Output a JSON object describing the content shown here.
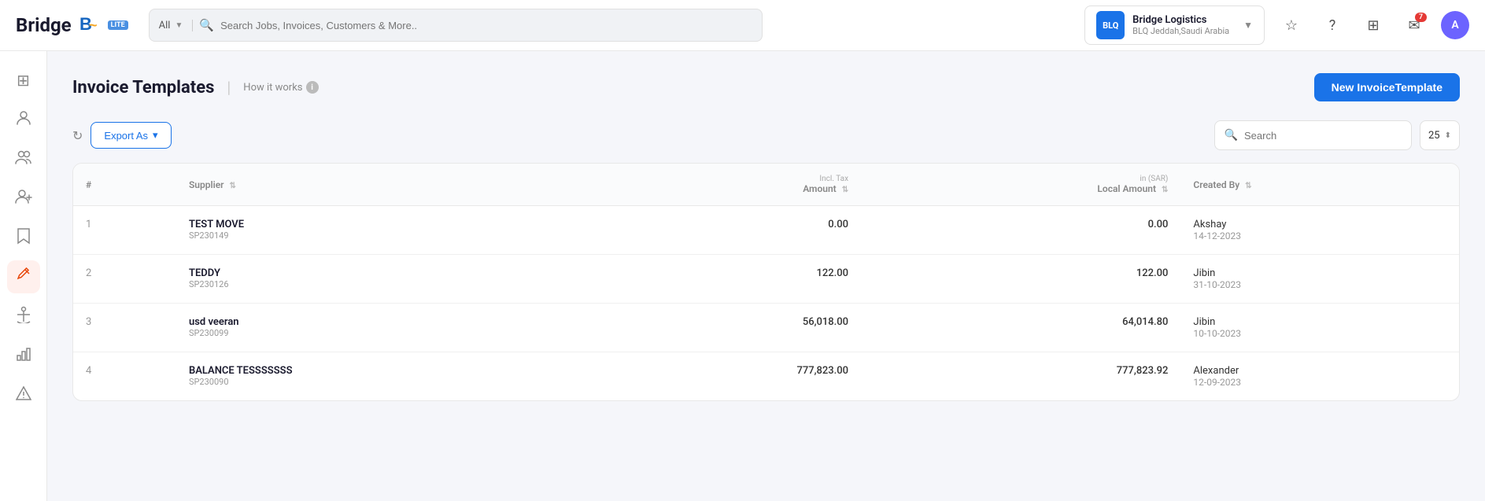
{
  "app": {
    "logo_text": "Bridge",
    "logo_badge": "LITE",
    "logo_icon_text": "B"
  },
  "topnav": {
    "search_dropdown_label": "All",
    "search_placeholder": "Search Jobs, Invoices, Customers & More..",
    "company": {
      "logo_text": "BLQ",
      "name": "Bridge Logistics",
      "sub": "BLQ Jeddah,Saudi Arabia"
    },
    "notifications_badge": "7",
    "avatar_text": "A"
  },
  "sidebar": {
    "items": [
      {
        "icon": "⊞",
        "name": "dashboard-icon",
        "active": false
      },
      {
        "icon": "👤",
        "name": "person-icon",
        "active": false
      },
      {
        "icon": "👥",
        "name": "group-icon",
        "active": false
      },
      {
        "icon": "➕",
        "name": "add-person-icon",
        "active": false
      },
      {
        "icon": "🔖",
        "name": "bookmark-icon",
        "active": false
      },
      {
        "icon": "✏️",
        "name": "edit-icon",
        "active": true
      },
      {
        "icon": "⚓",
        "name": "anchor-icon",
        "active": false
      },
      {
        "icon": "📊",
        "name": "chart-icon",
        "active": false
      },
      {
        "icon": "⚠️",
        "name": "alert-icon",
        "active": false
      }
    ]
  },
  "page": {
    "title": "Invoice Templates",
    "how_it_works": "How it works",
    "new_template_btn": "New InvoiceTemplate"
  },
  "toolbar": {
    "export_btn": "Export As",
    "search_placeholder": "Search",
    "per_page": "25"
  },
  "table": {
    "columns": [
      {
        "key": "num",
        "label": "#",
        "sortable": false
      },
      {
        "key": "supplier",
        "label": "Supplier",
        "sortable": true
      },
      {
        "key": "amount",
        "label": "Amount",
        "sub": "Incl. Tax",
        "sortable": true,
        "align": "right"
      },
      {
        "key": "local_amount",
        "label": "Local Amount",
        "sub": "in (SAR)",
        "sortable": true,
        "align": "right"
      },
      {
        "key": "created_by",
        "label": "Created By",
        "sortable": true
      }
    ],
    "rows": [
      {
        "num": "1",
        "supplier_name": "TEST MOVE",
        "supplier_code": "SP230149",
        "amount": "0.00",
        "local_amount": "0.00",
        "created_by": "Akshay",
        "created_date": "14-12-2023"
      },
      {
        "num": "2",
        "supplier_name": "TEDDY",
        "supplier_code": "SP230126",
        "amount": "122.00",
        "local_amount": "122.00",
        "created_by": "Jibin",
        "created_date": "31-10-2023"
      },
      {
        "num": "3",
        "supplier_name": "usd veeran",
        "supplier_code": "SP230099",
        "amount": "56,018.00",
        "local_amount": "64,014.80",
        "created_by": "Jibin",
        "created_date": "10-10-2023"
      },
      {
        "num": "4",
        "supplier_name": "BALANCE TESSSSSSS",
        "supplier_code": "SP230090",
        "amount": "777,823.00",
        "local_amount": "777,823.92",
        "created_by": "Alexander",
        "created_date": "12-09-2023"
      }
    ]
  }
}
